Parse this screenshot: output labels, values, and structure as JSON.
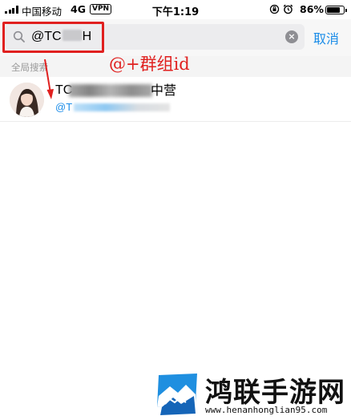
{
  "status_bar": {
    "carrier": "中国移动",
    "network": "4G",
    "vpn": "VPN",
    "time": "下午1:19",
    "battery": "86%",
    "battery_level": 0.86
  },
  "search": {
    "value_prefix": "@TC",
    "value_suffix": "H",
    "cancel_label": "取消"
  },
  "section": {
    "label": "全局搜索"
  },
  "result": {
    "name_prefix": "TC",
    "name_suffix": "中营",
    "sub_prefix": "@T"
  },
  "annotation": {
    "text": "@+群组id"
  },
  "watermark": {
    "title": "鸿联手游网",
    "url": "www.henanhonglian95.com"
  },
  "colors": {
    "accent": "#1a8ce8",
    "annotation": "#e0201f"
  }
}
